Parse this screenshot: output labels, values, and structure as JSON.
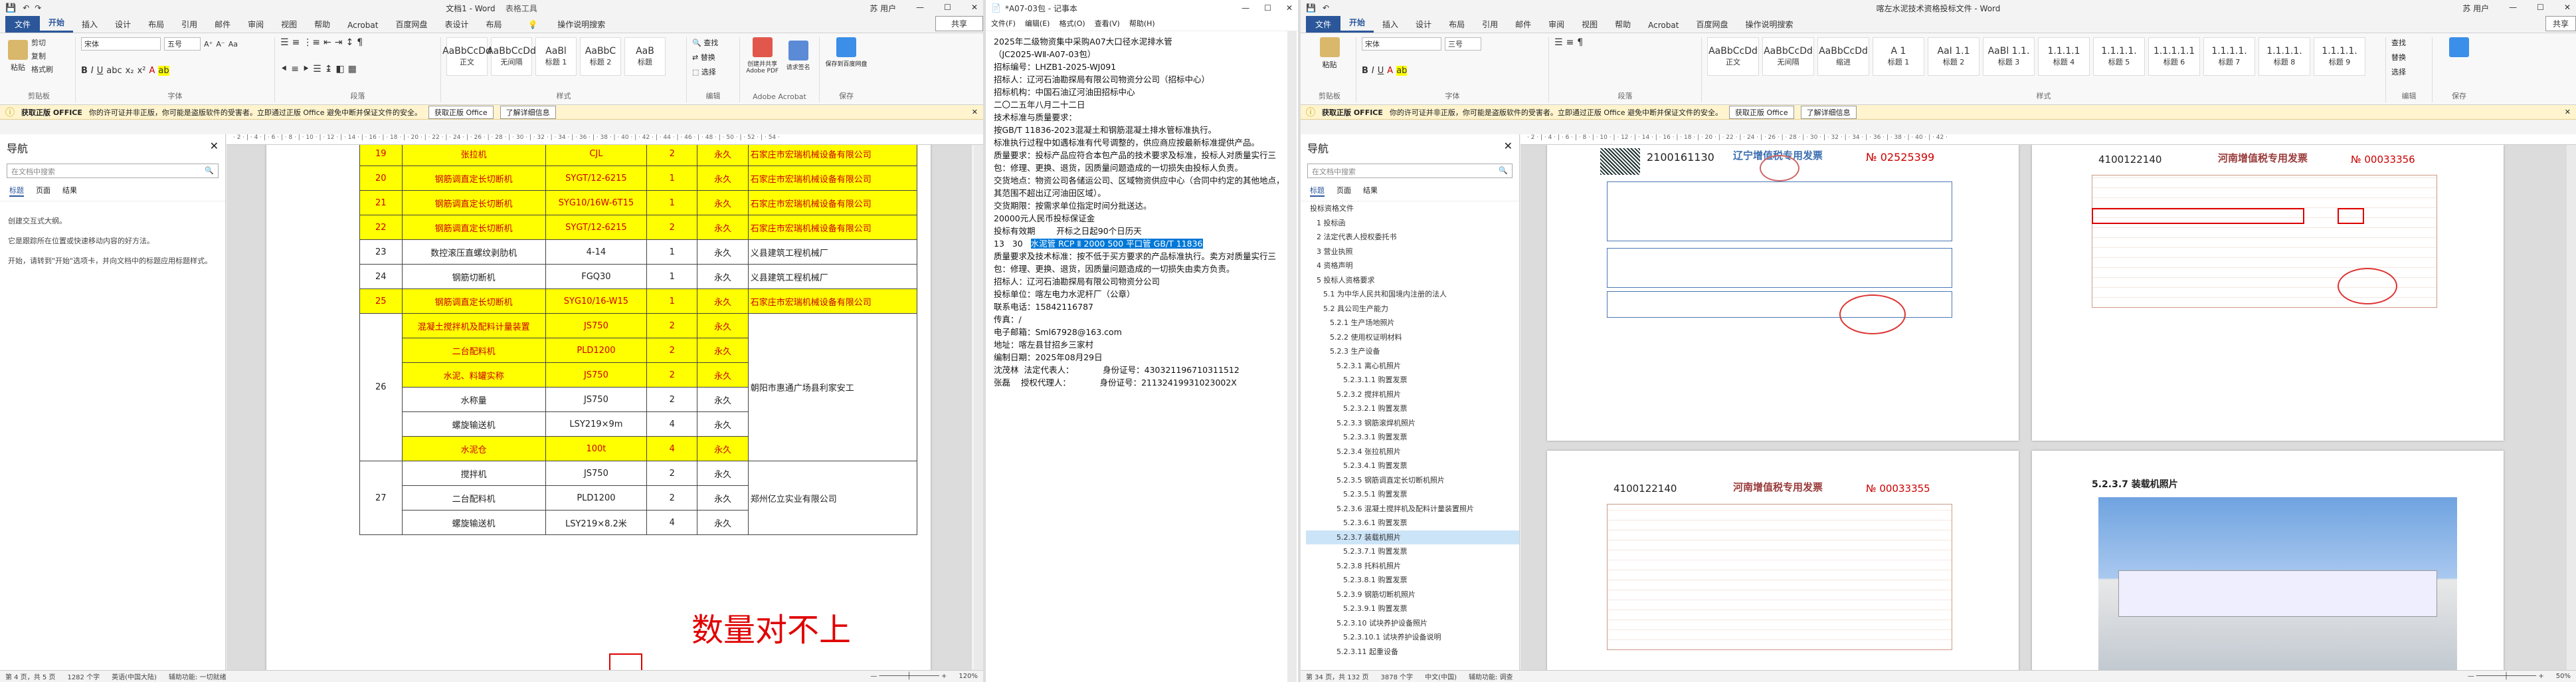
{
  "w1": {
    "title": "文档1 - Word",
    "tool_context": "表格工具",
    "title_right": "苏 用户",
    "tabs": [
      "文件",
      "开始",
      "插入",
      "设计",
      "布局",
      "引用",
      "邮件",
      "审阅",
      "视图",
      "帮助",
      "Acrobat",
      "百度网盘",
      "表设计",
      "布局",
      "操作说明搜索"
    ],
    "share": "共享",
    "clipboard": {
      "paste": "粘贴",
      "cut": "剪切",
      "copy": "复制",
      "format": "格式刷",
      "label": "剪贴板"
    },
    "font": {
      "name": "宋体",
      "size": "五号",
      "label": "字体"
    },
    "paragraph_label": "段落",
    "styles": [
      {
        "preview": "AaBbCcDd",
        "name": "正文"
      },
      {
        "preview": "AaBbCcDd",
        "name": "无间隔"
      },
      {
        "preview": "AaBl",
        "name": "标题 1"
      },
      {
        "preview": "AaBbC",
        "name": "标题 2"
      },
      {
        "preview": "AaB",
        "name": "标题"
      }
    ],
    "styles_label": "样式",
    "editing": {
      "find": "查找",
      "replace": "替换",
      "select": "选择",
      "label": "编辑"
    },
    "pdf": {
      "a": "创建并共享 Adobe PDF",
      "b": "请求签名",
      "label": "Adobe Acrobat"
    },
    "save": {
      "a": "保存到百度网盘",
      "label": "保存"
    },
    "msg": {
      "bold": "获取正版 OFFICE",
      "text": "你的许可证并非正版，你可能是盗版软件的受害者。立即通过正版 Office 避免中断并保证文件的安全。",
      "btn1": "获取正版 Office",
      "btn2": "了解详细信息"
    },
    "nav": {
      "title": "导航",
      "search": "在文档中搜索",
      "tabs": [
        "标题",
        "页面",
        "结果"
      ],
      "hint1": "创建交互式大纲。",
      "hint2": "它是跟踪所在位置或快速移动内容的好方法。",
      "hint3": "开始，请转到\"开始\"选项卡，并向文档中的标题应用标题样式。"
    },
    "rows": [
      {
        "no": "19",
        "name": "张拉机",
        "model": "CJL",
        "qty": "2",
        "years": "永久",
        "owner": "石家庄市宏瑞机械设备有限公司",
        "hl": true
      },
      {
        "no": "20",
        "name": "钢筋调直定长切断机",
        "model": "SYGT/12-6215",
        "qty": "1",
        "years": "永久",
        "owner": "石家庄市宏瑞机械设备有限公司",
        "hl": true
      },
      {
        "no": "21",
        "name": "钢筋调直定长切断机",
        "model": "SYG10/16W-6T15",
        "qty": "1",
        "years": "永久",
        "owner": "石家庄市宏瑞机械设备有限公司",
        "hl": true
      },
      {
        "no": "22",
        "name": "钢筋调直定长切断机",
        "model": "SYGT/12-6215",
        "qty": "2",
        "years": "永久",
        "owner": "石家庄市宏瑞机械设备有限公司",
        "hl": true
      },
      {
        "no": "23",
        "name": "数控滚压直螺纹剥肋机",
        "model": "4-14",
        "qty": "1",
        "years": "永久",
        "owner": "义县建筑工程机械厂",
        "hl": false
      },
      {
        "no": "24",
        "name": "钢筋切断机",
        "model": "FGQ30",
        "qty": "1",
        "years": "永久",
        "owner": "义县建筑工程机械厂",
        "hl": false
      },
      {
        "no": "25",
        "name": "钢筋调直定长切断机",
        "model": "SYG10/16-W15",
        "qty": "1",
        "years": "永久",
        "owner": "石家庄市宏瑞机械设备有限公司",
        "hl": true
      }
    ],
    "group26": {
      "no": "26",
      "owner": "朝阳市惠通广场县利家安工",
      "items": [
        {
          "name": "混凝土搅拌机及配料计量装置",
          "model": "JS750",
          "qty": "2",
          "years": "永久",
          "hl": true
        },
        {
          "name": "二台配料机",
          "model": "PLD1200",
          "qty": "2",
          "years": "永久",
          "hl": true
        },
        {
          "name": "水泥、料罐实称",
          "model": "JS750",
          "qty": "2",
          "years": "永久",
          "hl": true
        },
        {
          "name": "水称量",
          "model": "JS750",
          "qty": "2",
          "years": "永久",
          "hl": false
        },
        {
          "name": "螺旋输送机",
          "model": "LSY219×9m",
          "qty": "4",
          "years": "永久",
          "hl": false
        },
        {
          "name": "水泥仓",
          "model": "100t",
          "qty": "4",
          "years": "永久",
          "hl": true
        }
      ]
    },
    "group27": {
      "no": "27",
      "owner": "郑州亿立实业有限公司",
      "items": [
        {
          "name": "搅拌机",
          "model": "JS750",
          "qty": "2",
          "years": "永久",
          "hl": false
        },
        {
          "name": "二台配料机",
          "model": "PLD1200",
          "qty": "2",
          "years": "永久",
          "hl": false
        },
        {
          "name": "螺旋输送机",
          "model": "LSY219×8.2米",
          "qty": "4",
          "years": "永久",
          "hl": false
        }
      ]
    },
    "annotation": "数量对不上",
    "status": {
      "page": "第 4 页，共 5 页",
      "words": "1282 个字",
      "lang": "英语(中国大陆)",
      "accessibility": "辅助功能: 一切就绪",
      "zoom": "120%"
    }
  },
  "w2": {
    "title": "*A07-03包 - 记事本",
    "menu": [
      "文件(F)",
      "编辑(E)",
      "格式(O)",
      "查看(V)",
      "帮助(H)"
    ],
    "lines": [
      "2025年二级物资集中采购A07大口径水泥排水管",
      "（JC2025-WⅡ-A07-03包）",
      "",
      "招标编号：LHZB1-2025-WJ091",
      "",
      "招标人：辽河石油勘探局有限公司物资分公司（招标中心）",
      "",
      "招标机构：中国石油辽河油田招标中心",
      "",
      "二〇二五年八月二十二日",
      "",
      "技术标准与质量要求：",
      "按GB/T 11836-2023混凝土和钢筋混凝土排水管标准执行。",
      "标准执行过程中如遇标准有代号调整的，供应商应按最新标准提供产品。",
      "",
      "质量要求：投标产品应符合本包产品的技术要求及标准，投标人对质量实行三包：修理、更换、退货，因质量问题造成的一切损失由投标人负责。",
      "",
      "交货地点：物资公司各储运公司、区域物资供应中心（合同中约定的其他地点，其范围不超出辽河油田区域）。",
      "",
      "交货期限：按需求单位指定时间分批送达。",
      "",
      "20000元人民币投标保证金",
      "",
      "投标有效期        开标之日起90个日历天",
      "",
      "13   30   "
    ],
    "selected": "水泥管 RCP Ⅱ 2000 500 平口管 GB/T 11836",
    "lines2": [
      "",
      "质量要求及技术标准：按不低于买方要求的产品标准执行。卖方对质量实行三包：修理、更换、退货，因质量问题造成的一切损失由卖方负责。",
      "",
      "招标人：辽河石油勘探局有限公司物资分公司",
      "投标单位：喀左电力水泥杆厂（公章）",
      "联系电话：15842116787",
      "传真：/",
      "电子邮箱：Sml67928@163.com",
      "地址：喀左县甘招乡三家村",
      "编制日期：2025年08月29日",
      "",
      "沈茂林  法定代表人：           身份证号：430321196710311512",
      "张磊    授权代理人：           身份证号：211324199310230​02X"
    ]
  },
  "w3": {
    "title": "喀左水泥技术资格投标文件 - Word",
    "title_right": "苏 用户",
    "tabs": [
      "文件",
      "开始",
      "插入",
      "设计",
      "布局",
      "引用",
      "邮件",
      "审阅",
      "视图",
      "帮助",
      "Acrobat",
      "百度网盘",
      "操作说明搜索"
    ],
    "share": "共享",
    "font": {
      "name": "宋体",
      "size": "三号"
    },
    "styles": [
      {
        "preview": "AaBbCcDd",
        "name": "正文"
      },
      {
        "preview": "AaBbCcDd",
        "name": "无间隔"
      },
      {
        "preview": "AaBbCcDd",
        "name": "缩进"
      },
      {
        "preview": "A 1",
        "name": "标题 1"
      },
      {
        "preview": "AaI 1.1",
        "name": "标题 2"
      },
      {
        "preview": "AaBl 1.1.",
        "name": "标题 3"
      },
      {
        "preview": "1.1.1.1",
        "name": "标题 4"
      },
      {
        "preview": "1.1.1.1.",
        "name": "标题 5"
      },
      {
        "preview": "1.1.1.1.1",
        "name": "标题 6"
      },
      {
        "preview": "1.1.1.1.",
        "name": "标题 7"
      },
      {
        "preview": "1.1.1.1.",
        "name": "标题 8"
      },
      {
        "preview": "1.1.1.1.",
        "name": "标题 9"
      }
    ],
    "msg": {
      "bold": "获取正版 OFFICE",
      "text": "你的许可证并非正版，你可能是盗版软件的受害者。立即通过正版 Office 避免中断并保证文件的安全。",
      "btn1": "获取正版 Office",
      "btn2": "了解详细信息"
    },
    "nav": {
      "title": "导航",
      "search": "在文档中搜索",
      "tabs": [
        "标题",
        "页面",
        "结果"
      ],
      "tree": [
        "投标资格文件",
        "1 投标函",
        "2 法定代表人授权委托书",
        "3 营业执照",
        "4 资格声明",
        "5 投标人资格要求",
        "5.1 为中华人民共和国境内注册的法人",
        "5.2 具公司生产能力",
        "5.2.1 生产场地照片",
        "5.2.2 使用权证明材料",
        "5.2.3 生产设备",
        "5.2.3.1 离心机照片",
        "5.2.3.1.1 购置发票",
        "5.2.3.2 搅拌机照片",
        "5.2.3.2.1 购置发票",
        "5.2.3.3 钢筋滚焊机照片",
        "5.2.3.3.1 购置发票",
        "5.2.3.4 张拉机照片",
        "5.2.3.4.1 购置发票",
        "5.2.3.5 钢筋调直定长切断机照片",
        "5.2.3.5.1 购置发票",
        "5.2.3.6 混凝土搅拌机及配料计量装置照片",
        "5.2.3.6.1 购置发票",
        "5.2.3.7 装载机照片",
        "5.2.3.7.1 购置发票",
        "5.2.3.8 托料机照片",
        "5.2.3.8.1 购置发票",
        "5.2.3.9 钢筋切断机照片",
        "5.2.3.9.1 购置发票",
        "5.2.3.10 试块养护设备照片",
        "5.2.3.10.1 试块养护设备说明",
        "5.2.3.11 起重设备"
      ],
      "active": "5.2.3.7 装载机照片"
    },
    "pages": {
      "inv1_code": "2100161130",
      "inv1_no": "02525399",
      "inv2_code": "4100122140",
      "inv2_no": "00033356",
      "inv3_code": "4100122140",
      "inv3_no": "00033355",
      "inv_title_a": "辽宁增值税专用发票",
      "inv_title_b": "河南增值税专用发票",
      "photo_heading": "5.2.3.7   装载机照片"
    },
    "status": {
      "page": "第 34 页，共 132 页",
      "words": "3878 个字",
      "lang": "中文(中国)",
      "accessibility": "辅助功能: 调查",
      "zoom": "50%"
    }
  },
  "colors": {
    "word_blue": "#2b579a",
    "highlight": "#ffff00",
    "annotation_red": "#e00000",
    "selection_blue": "#0078d7"
  }
}
